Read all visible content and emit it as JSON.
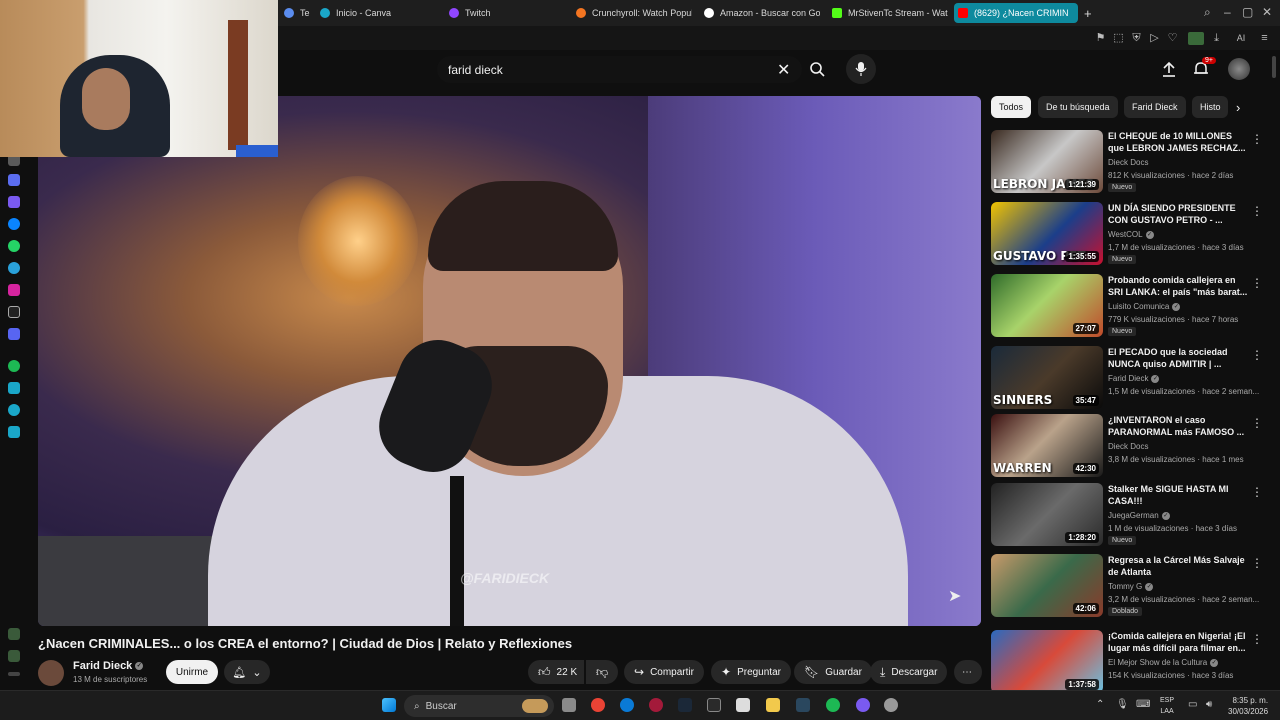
{
  "browser": {
    "tabs": [
      {
        "label": "Tem",
        "color": "#5b8def"
      },
      {
        "label": "Inicio - Canva",
        "color": "#1aa7c9"
      },
      {
        "label": "Twitch",
        "color": "#9146ff"
      },
      {
        "label": "Crunchyroll: Watch Popul",
        "color": "#f47521"
      },
      {
        "label": "Amazon - Buscar con Go",
        "color": "#ffffff"
      },
      {
        "label": "MrStivenTc Stream - Watc",
        "color": "#53fc18"
      },
      {
        "label": "(8629) ¿Nacen CRIMIN",
        "color": "#ff0000"
      }
    ]
  },
  "header": {
    "search_value": "farid dieck",
    "notifications": "9+"
  },
  "player": {
    "watermark": "@FARIDIECK"
  },
  "video": {
    "title": "¿Nacen CRIMINALES... o los CREA el entorno? | Ciudad de Dios | Relato y Reflexiones",
    "channel": "Farid Dieck",
    "subscribers": "13 M de suscriptores",
    "join_label": "Unirme",
    "likes": "22 K",
    "share_label": "Compartir",
    "ask_label": "Preguntar",
    "save_label": "Guardar",
    "download_label": "Descargar"
  },
  "chips": [
    "Todos",
    "De tu búsqueda",
    "Farid Dieck",
    "Histo"
  ],
  "recommendations": [
    {
      "title": "El CHEQUE de 10 MILLONES que LEBRON JAMES RECHAZ...",
      "channel": "Dieck Docs",
      "verified": false,
      "stats": "812 K visualizaciones · hace 2 días",
      "badge": "Nuevo",
      "duration": "1:21:39",
      "overlay": "LEBRON JAMES",
      "thumb": "linear-gradient(135deg,#3a2a20,#c7c7c7 50%,#6d4a3a)"
    },
    {
      "title": "UN DÍA SIENDO PRESIDENTE CON GUSTAVO PETRO - ...",
      "channel": "WestCOL",
      "verified": true,
      "stats": "1,7 M de visualizaciones · hace 3 días",
      "badge": "Nuevo",
      "duration": "1:35:55",
      "overlay": "GUSTAVO PET",
      "thumb": "linear-gradient(135deg,#f2c400,#1b3e8a 55%,#c8102e)"
    },
    {
      "title": "Probando comida callejera en SRI LANKA: el país \"más barat...",
      "channel": "Luisito Comunica",
      "verified": true,
      "stats": "779 K visualizaciones · hace 7 horas",
      "badge": "Nuevo",
      "duration": "27:07",
      "overlay": "",
      "thumb": "linear-gradient(135deg,#2f6b2a,#a8d36a 45%,#c04a2a)"
    },
    {
      "title": "El PECADO que la sociedad NUNCA quiso ADMITIR | ...",
      "channel": "Farid Dieck",
      "verified": true,
      "stats": "1,5 M de visualizaciones · hace 2 seman...",
      "badge": "",
      "duration": "35:47",
      "overlay": "SINNERS",
      "thumb": "linear-gradient(135deg,#1a2a3a,#4a3a2a 50%,#0a0a0a)"
    },
    {
      "title": "¿INVENTARON el caso PARANORMAL más FAMOSO ...",
      "channel": "Dieck Docs",
      "verified": false,
      "stats": "3,8 M de visualizaciones · hace 1 mes",
      "badge": "",
      "duration": "42:30",
      "overlay": "WARREN",
      "thumb": "linear-gradient(135deg,#3a1010,#b9a28a 45%,#1a1a1a)"
    },
    {
      "title": "Stalker Me SIGUE HASTA MI CASA!!!",
      "channel": "JuegaGerman",
      "verified": true,
      "stats": "1 M de visualizaciones · hace 3 días",
      "badge": "Nuevo",
      "duration": "1:28:20",
      "overlay": "",
      "thumb": "linear-gradient(135deg,#222,#6a6a6a 50%,#2a2a2a)"
    },
    {
      "title": "Regresa a la Cárcel Más Salvaje de Atlanta",
      "channel": "Tommy G",
      "verified": true,
      "stats": "3,2 M de visualizaciones · hace 2 seman...",
      "badge": "Doblado",
      "duration": "42:06",
      "overlay": "",
      "thumb": "linear-gradient(135deg,#c89a6a,#3a6a4a 50%,#8a3a2a)"
    },
    {
      "title": "¡Comida callejera en Nigeria! ¡El lugar más difícil para filmar en...",
      "channel": "El Mejor Show de la Cultura",
      "verified": true,
      "stats": "154 K visualizaciones · hace 3 días",
      "badge": "",
      "duration": "1:37:58",
      "overlay": "",
      "thumb": "linear-gradient(135deg,#2a6ac0,#d84a3a 50%,#6ac0e0)"
    }
  ],
  "taskbar": {
    "search_placeholder": "Buscar",
    "lang_1": "ESP",
    "lang_2": "LAA",
    "time": "8:35 p. m.",
    "date": "30/03/2026"
  }
}
